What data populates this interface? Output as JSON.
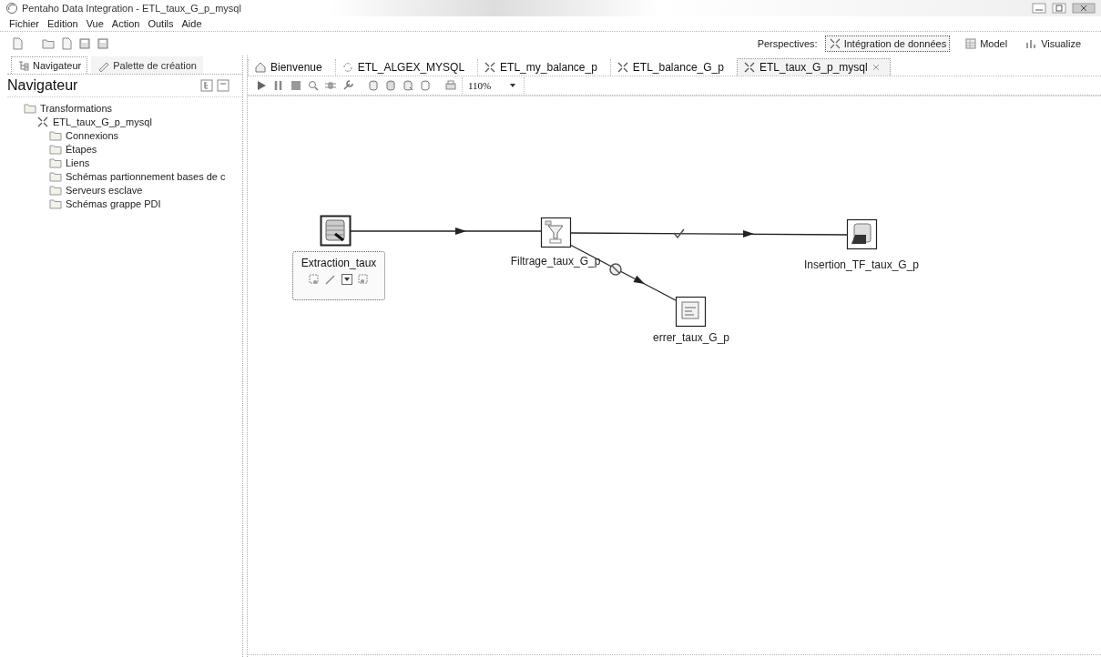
{
  "window": {
    "title": "Pentaho Data Integration - ETL_taux_G_p_mysql"
  },
  "menu": [
    "Fichier",
    "Edition",
    "Vue",
    "Action",
    "Outils",
    "Aide"
  ],
  "perspectives": {
    "label": "Perspectives:",
    "items": [
      {
        "label": "Intégration de données",
        "kind": "data",
        "selected": true
      },
      {
        "label": "Model",
        "kind": "model",
        "selected": false
      },
      {
        "label": "Visualize",
        "kind": "visualize",
        "selected": false
      }
    ]
  },
  "left_tabs": [
    {
      "label": "Navigateur",
      "kind": "navigator",
      "selected": true
    },
    {
      "label": "Palette de création",
      "kind": "palette",
      "selected": false
    }
  ],
  "navigator": {
    "title": "Navigateur",
    "tree": [
      {
        "label": "Transformations",
        "kind": "folder",
        "children": [
          {
            "label": "ETL_taux_G_p_mysql",
            "kind": "transformation",
            "children": [
              {
                "label": "Connexions",
                "kind": "folder"
              },
              {
                "label": "Étapes",
                "kind": "folder"
              },
              {
                "label": "Liens",
                "kind": "folder"
              },
              {
                "label": "Schémas partionnement bases de c",
                "kind": "folder"
              },
              {
                "label": "Serveurs esclave",
                "kind": "folder"
              },
              {
                "label": "Schémas grappe PDI",
                "kind": "folder"
              }
            ]
          }
        ]
      }
    ]
  },
  "editor_tabs": [
    {
      "label": "Bienvenue",
      "kind": "welcome",
      "selected": false
    },
    {
      "label": "ETL_ALGEX_MYSQL",
      "kind": "job",
      "selected": false
    },
    {
      "label": "ETL_my_balance_p",
      "kind": "transformation",
      "selected": false
    },
    {
      "label": "ETL_balance_G_p",
      "kind": "transformation",
      "selected": false
    },
    {
      "label": "ETL_taux_G_p_mysql",
      "kind": "transformation",
      "selected": true
    }
  ],
  "zoom": {
    "value": "110%"
  },
  "canvas": {
    "steps": [
      {
        "name": "Extraction_taux",
        "kind": "input",
        "selected": true
      },
      {
        "name": "Filtrage_taux_G_p",
        "kind": "filter",
        "selected": false
      },
      {
        "name": "Insertion_TF_taux_G_p",
        "kind": "output",
        "selected": false
      },
      {
        "name": "errer_taux_G_p",
        "kind": "file",
        "selected": false
      }
    ],
    "hops": [
      {
        "kind": "normal"
      },
      {
        "kind": "true"
      },
      {
        "kind": "error"
      }
    ]
  }
}
